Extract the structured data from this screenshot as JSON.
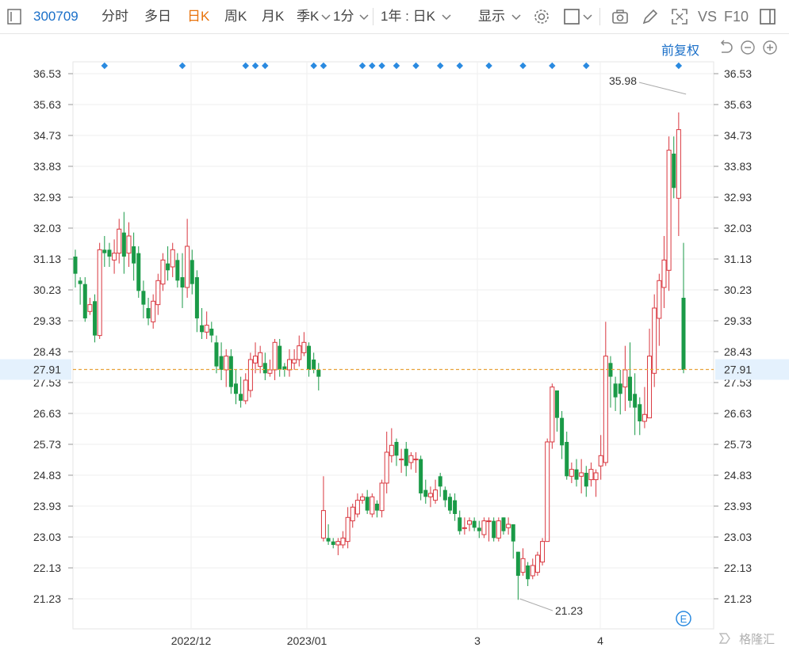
{
  "toolbar": {
    "stock_code": "300709",
    "periods": [
      "分时",
      "多日",
      "日K",
      "周K",
      "月K",
      "季K",
      "1分"
    ],
    "active_period": "日K",
    "range_label": "1年 : 日K",
    "display_label": "显示",
    "vs_label": "VS",
    "f10_label": "F10"
  },
  "fuquan_label": "前复权",
  "watermark": "格隆汇",
  "event_marker_label": "E",
  "chart_data": {
    "type": "candlestick",
    "ylim": [
      20.8,
      37.0
    ],
    "y_ticks": [
      "36.53",
      "35.63",
      "34.73",
      "33.83",
      "32.93",
      "32.03",
      "31.13",
      "30.23",
      "29.33",
      "28.43",
      "27.53",
      "26.63",
      "25.73",
      "24.83",
      "23.93",
      "23.03",
      "22.13",
      "21.23"
    ],
    "x_labels": [
      "2022/12",
      "2023/01",
      "3",
      "4"
    ],
    "current_price": "27.91",
    "high_label": "35.98",
    "low_label": "21.23",
    "up_color": "#d9363e",
    "down_color": "#1a9a47",
    "candles": [
      [
        31.2,
        30.7,
        31.4,
        30.3
      ],
      [
        30.5,
        30.4,
        30.6,
        29.8
      ],
      [
        30.4,
        29.4,
        30.6,
        29.3
      ],
      [
        29.6,
        29.8,
        30.0,
        29.5
      ],
      [
        29.9,
        28.9,
        30.1,
        28.7
      ],
      [
        28.9,
        31.4,
        31.6,
        28.8
      ],
      [
        31.4,
        31.3,
        31.8,
        30.9
      ],
      [
        31.4,
        31.2,
        31.6,
        30.9
      ],
      [
        31.1,
        31.3,
        31.7,
        30.7
      ],
      [
        31.3,
        32.0,
        32.3,
        31.0
      ],
      [
        31.9,
        31.2,
        32.5,
        30.7
      ],
      [
        31.3,
        31.8,
        32.2,
        30.9
      ],
      [
        31.5,
        31.0,
        31.9,
        30.5
      ],
      [
        31.3,
        30.2,
        31.5,
        30.0
      ],
      [
        30.2,
        29.8,
        30.5,
        29.4
      ],
      [
        29.7,
        29.4,
        30.0,
        29.2
      ],
      [
        29.3,
        29.9,
        30.1,
        29.1
      ],
      [
        29.8,
        30.5,
        30.7,
        29.5
      ],
      [
        30.4,
        31.1,
        31.3,
        30.2
      ],
      [
        31.0,
        30.8,
        31.5,
        30.5
      ],
      [
        30.9,
        31.4,
        31.6,
        30.6
      ],
      [
        31.1,
        30.5,
        31.3,
        30.3
      ],
      [
        30.6,
        30.3,
        31.3,
        29.7
      ],
      [
        30.3,
        31.5,
        32.3,
        30.0
      ],
      [
        31.1,
        30.4,
        31.4,
        30.1
      ],
      [
        30.6,
        29.4,
        30.8,
        29.0
      ],
      [
        29.2,
        29.0,
        29.7,
        28.8
      ],
      [
        29.0,
        29.2,
        29.6,
        28.8
      ],
      [
        29.1,
        28.9,
        29.3,
        28.7
      ],
      [
        28.7,
        28.0,
        28.9,
        27.8
      ],
      [
        28.3,
        27.9,
        28.7,
        27.6
      ],
      [
        27.9,
        28.3,
        28.5,
        27.4
      ],
      [
        28.3,
        27.4,
        28.5,
        27.2
      ],
      [
        27.5,
        27.2,
        27.9,
        26.9
      ],
      [
        27.2,
        27.0,
        27.7,
        26.8
      ],
      [
        27.0,
        27.6,
        27.8,
        26.9
      ],
      [
        27.3,
        28.2,
        28.4,
        27.1
      ],
      [
        28.1,
        28.3,
        28.7,
        27.8
      ],
      [
        28.0,
        28.4,
        28.6,
        27.8
      ],
      [
        28.1,
        27.8,
        28.4,
        27.6
      ],
      [
        27.8,
        27.9,
        28.2,
        27.7
      ],
      [
        27.9,
        28.7,
        28.8,
        27.6
      ],
      [
        28.6,
        27.9,
        28.8,
        27.7
      ],
      [
        28.0,
        27.9,
        28.1,
        27.7
      ],
      [
        27.9,
        28.2,
        28.5,
        27.7
      ],
      [
        28.1,
        28.2,
        28.5,
        27.9
      ],
      [
        28.2,
        28.6,
        28.9,
        28.0
      ],
      [
        28.4,
        28.7,
        29.0,
        28.3
      ],
      [
        28.6,
        27.9,
        28.7,
        27.7
      ],
      [
        28.2,
        27.9,
        28.4,
        27.8
      ],
      [
        27.9,
        27.7,
        28.1,
        27.3
      ],
      [
        23.0,
        23.8,
        24.8,
        22.9
      ],
      [
        23.0,
        22.9,
        23.4,
        22.8
      ],
      [
        22.9,
        22.8,
        23.0,
        22.7
      ],
      [
        22.8,
        22.9,
        23.0,
        22.5
      ],
      [
        22.8,
        23.0,
        23.2,
        22.7
      ],
      [
        22.9,
        23.6,
        23.9,
        22.7
      ],
      [
        23.5,
        23.9,
        24.0,
        23.3
      ],
      [
        23.7,
        24.1,
        24.3,
        23.6
      ],
      [
        24.1,
        24.2,
        24.3,
        24.0
      ],
      [
        24.2,
        23.8,
        24.4,
        23.7
      ],
      [
        23.7,
        24.2,
        24.3,
        23.6
      ],
      [
        24.0,
        23.8,
        24.1,
        23.6
      ],
      [
        23.8,
        24.6,
        24.7,
        23.6
      ],
      [
        24.6,
        25.5,
        26.1,
        24.3
      ],
      [
        25.4,
        25.7,
        26.2,
        25.2
      ],
      [
        25.8,
        25.4,
        25.9,
        25.1
      ],
      [
        25.3,
        25.3,
        25.6,
        24.9
      ],
      [
        25.6,
        25.1,
        25.8,
        24.8
      ],
      [
        25.2,
        25.4,
        25.5,
        25.0
      ],
      [
        25.3,
        25.3,
        25.5,
        24.9
      ],
      [
        25.3,
        24.3,
        25.4,
        24.1
      ],
      [
        24.4,
        24.2,
        24.7,
        24.0
      ],
      [
        24.2,
        24.3,
        24.5,
        23.9
      ],
      [
        24.1,
        24.4,
        24.7,
        24.0
      ],
      [
        24.8,
        24.5,
        24.9,
        24.2
      ],
      [
        24.4,
        24.1,
        24.5,
        23.9
      ],
      [
        24.2,
        23.8,
        24.3,
        23.7
      ],
      [
        24.1,
        23.7,
        24.3,
        23.5
      ],
      [
        23.6,
        23.2,
        23.8,
        23.1
      ],
      [
        23.3,
        23.3,
        23.6,
        23.1
      ],
      [
        23.4,
        23.5,
        23.6,
        23.2
      ],
      [
        23.5,
        23.3,
        23.6,
        23.2
      ],
      [
        23.3,
        23.2,
        23.5,
        23.0
      ],
      [
        23.1,
        23.5,
        23.6,
        23.0
      ],
      [
        23.5,
        23.5,
        23.6,
        22.9
      ],
      [
        23.5,
        23.0,
        23.6,
        22.9
      ],
      [
        23.0,
        23.5,
        23.6,
        22.9
      ],
      [
        23.6,
        23.2,
        23.6,
        23.1
      ],
      [
        23.3,
        23.4,
        23.6,
        23.1
      ],
      [
        23.4,
        22.9,
        23.4,
        22.4
      ],
      [
        22.6,
        21.9,
        22.6,
        21.2
      ],
      [
        22.0,
        22.4,
        22.7,
        21.9
      ],
      [
        22.2,
        21.8,
        22.3,
        21.6
      ],
      [
        21.9,
        22.2,
        22.4,
        21.8
      ],
      [
        22.0,
        22.5,
        22.6,
        21.9
      ],
      [
        22.3,
        22.9,
        23.0,
        22.2
      ],
      [
        22.9,
        25.8,
        25.9,
        22.9
      ],
      [
        25.8,
        27.4,
        27.5,
        25.6
      ],
      [
        27.3,
        26.5,
        27.3,
        26.1
      ],
      [
        26.5,
        25.7,
        26.7,
        25.3
      ],
      [
        25.8,
        24.8,
        26.1,
        24.7
      ],
      [
        24.8,
        25.0,
        25.2,
        24.6
      ],
      [
        25.0,
        24.7,
        25.3,
        24.5
      ],
      [
        24.8,
        24.9,
        25.3,
        24.3
      ],
      [
        24.9,
        24.5,
        25.1,
        24.2
      ],
      [
        24.7,
        25.0,
        25.2,
        24.5
      ],
      [
        24.7,
        24.9,
        25.0,
        24.2
      ],
      [
        25.1,
        25.4,
        26.0,
        24.7
      ],
      [
        25.2,
        28.3,
        29.3,
        25.1
      ],
      [
        28.1,
        27.7,
        28.3,
        26.8
      ],
      [
        27.5,
        27.1,
        27.7,
        26.7
      ],
      [
        27.5,
        27.2,
        27.9,
        26.6
      ],
      [
        27.4,
        27.9,
        28.6,
        26.7
      ],
      [
        27.7,
        27.0,
        28.7,
        26.8
      ],
      [
        27.2,
        26.8,
        27.8,
        26.0
      ],
      [
        26.9,
        26.4,
        27.1,
        26.0
      ],
      [
        26.4,
        26.6,
        27.4,
        26.2
      ],
      [
        26.5,
        28.3,
        29.1,
        26.5
      ],
      [
        27.8,
        29.7,
        30.1,
        27.4
      ],
      [
        29.4,
        30.5,
        30.7,
        28.6
      ],
      [
        30.3,
        31.1,
        31.8,
        29.7
      ],
      [
        30.8,
        34.3,
        34.7,
        30.2
      ],
      [
        34.2,
        33.2,
        34.7,
        32.9
      ],
      [
        32.9,
        34.9,
        35.4,
        31.8
      ],
      [
        30.0,
        27.9,
        31.6,
        27.8
      ]
    ]
  }
}
